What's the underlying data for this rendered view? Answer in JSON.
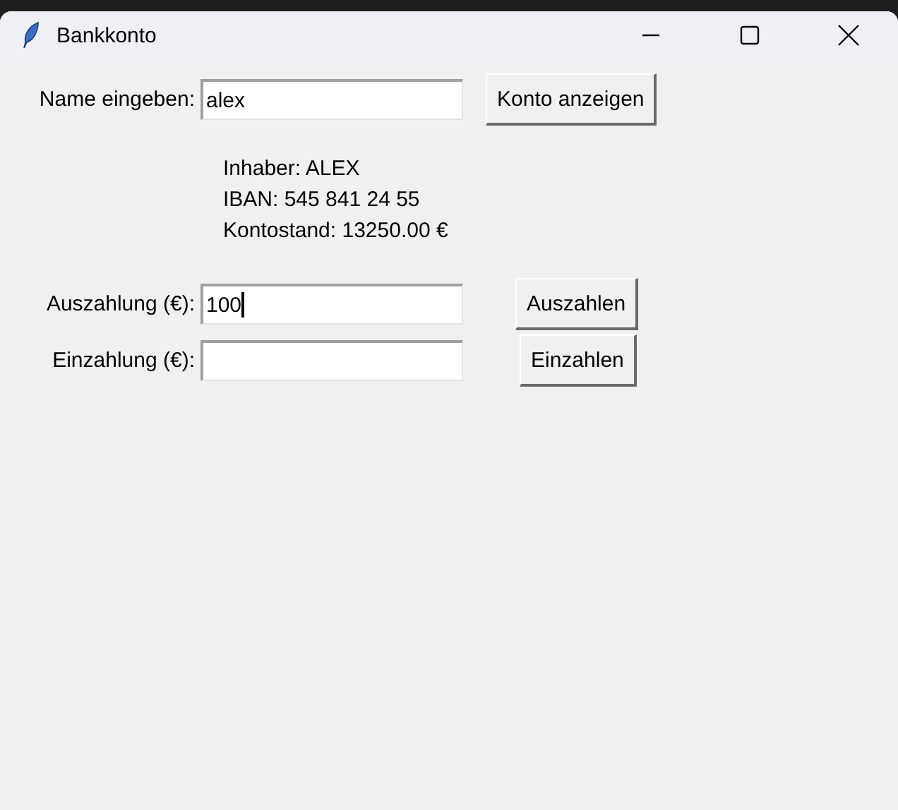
{
  "window": {
    "title": "Bankkonto"
  },
  "name_row": {
    "label": "Name eingeben:",
    "value": "alex",
    "button": "Konto anzeigen"
  },
  "account_info": [
    "Inhaber: ALEX",
    "IBAN: 545 841 24 55",
    "Kontostand: 13250.00 €"
  ],
  "transactions": [
    {
      "label": "Auszahlung (€):",
      "value": "100",
      "focused": true,
      "button": "Auszahlen"
    },
    {
      "label": "Einzahlung (€):",
      "focused": false,
      "button": "Einzahlen"
    }
  ]
}
